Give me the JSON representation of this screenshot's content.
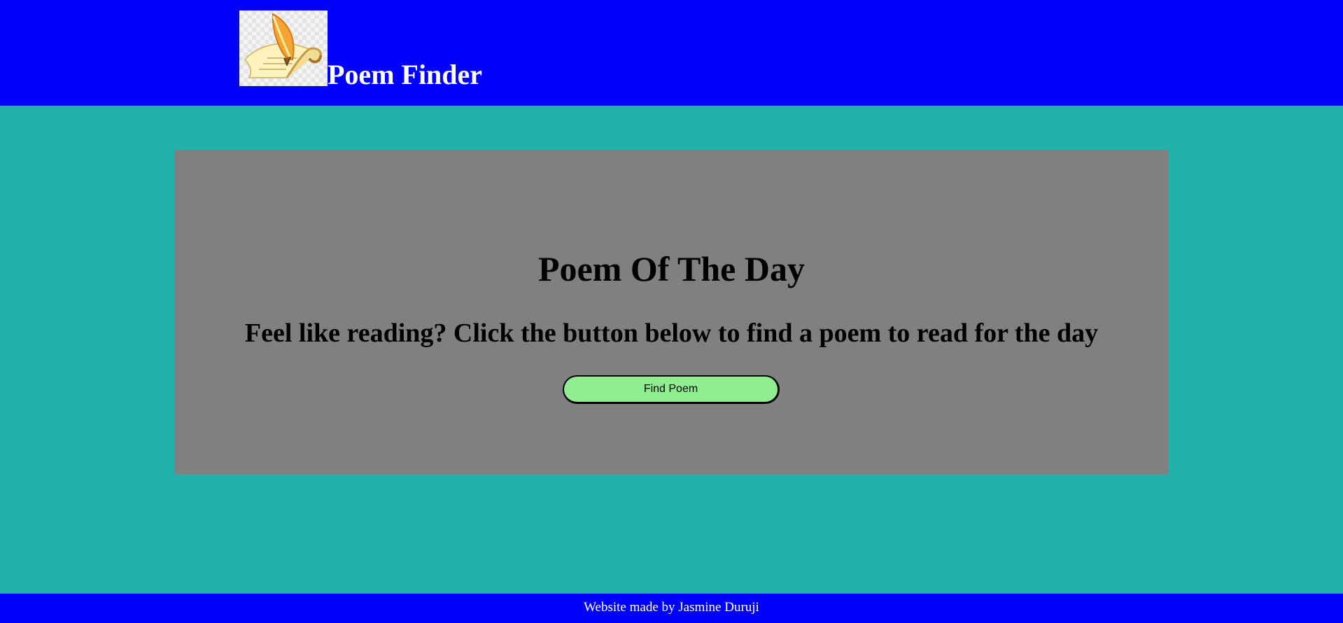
{
  "header": {
    "title": "Poem Finder",
    "logo_icon": "quill-scroll-icon",
    "background_color": "#0000ff",
    "text_color": "#ffffff"
  },
  "page": {
    "background_color": "#20b2aa"
  },
  "main": {
    "panel_color": "#808080",
    "title": "Poem Of The Day",
    "subtitle": "Feel like reading? Click the button below to find a poem to read for the day",
    "button_label": "Find Poem",
    "button_color": "#90ee90"
  },
  "footer": {
    "text": "Website made by Jasmine Duruji",
    "background_color": "#0000ff",
    "text_color": "#ffffff"
  }
}
